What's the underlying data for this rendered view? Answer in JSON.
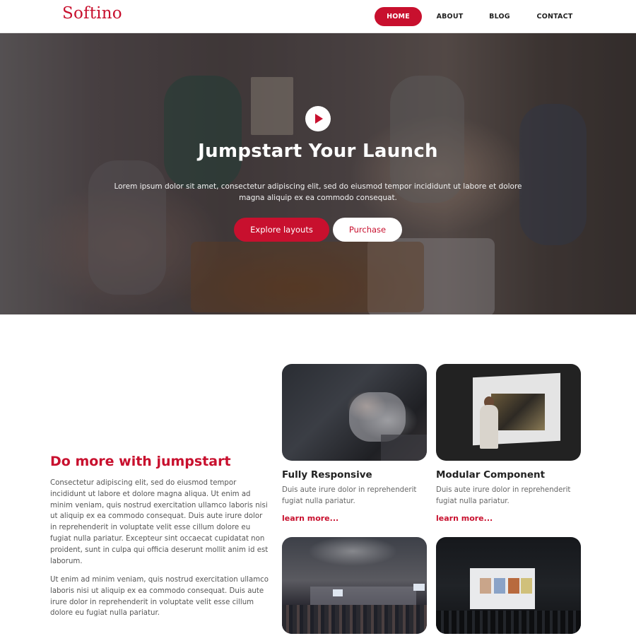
{
  "navbar": {
    "logo": "Softino",
    "items": [
      {
        "label": "HOME",
        "active": true
      },
      {
        "label": "ABOUT",
        "active": false
      },
      {
        "label": "BLOG",
        "active": false
      },
      {
        "label": "CONTACT",
        "active": false
      }
    ]
  },
  "hero": {
    "title": "Jumpstart Your Launch",
    "subtitle": "Lorem ipsum dolor sit amet, consectetur adipiscing elit, sed do eiusmod tempor incididunt ut labore et dolore magna aliquip ex ea commodo consequat.",
    "primary_button": "Explore layouts",
    "secondary_button": "Purchase",
    "play_icon": "play-icon"
  },
  "intro": {
    "title": "Do more with jumpstart",
    "paragraph_1": "Consectetur adipiscing elit, sed do eiusmod tempor incididunt ut labore et dolore magna aliqua. Ut enim ad minim veniam, quis nostrud exercitation ullamco laboris nisi ut aliquip ex ea commodo consequat. Duis aute irure dolor in reprehenderit in voluptate velit esse cillum dolore eu fugiat nulla pariatur. Excepteur sint occaecat cupidatat non proident, sunt in culpa qui officia deserunt mollit anim id est laborum.",
    "paragraph_2": "Ut enim ad minim veniam, quis nostrud exercitation ullamco laboris nisi ut aliquip ex ea commodo consequat. Duis aute irure dolor in reprehenderit in voluptate velit esse cillum dolore eu fugiat nulla pariatur."
  },
  "features": [
    {
      "title": "Fully Responsive",
      "text": "Duis aute irure dolor in reprehenderit fugiat nulla pariatur.",
      "link": "learn more..."
    },
    {
      "title": "Modular Component",
      "text": "Duis aute irure dolor in reprehenderit fugiat nulla pariatur.",
      "link": "learn more..."
    }
  ],
  "colors": {
    "accent": "#c8102e",
    "text": "#444444",
    "background": "#ffffff"
  }
}
